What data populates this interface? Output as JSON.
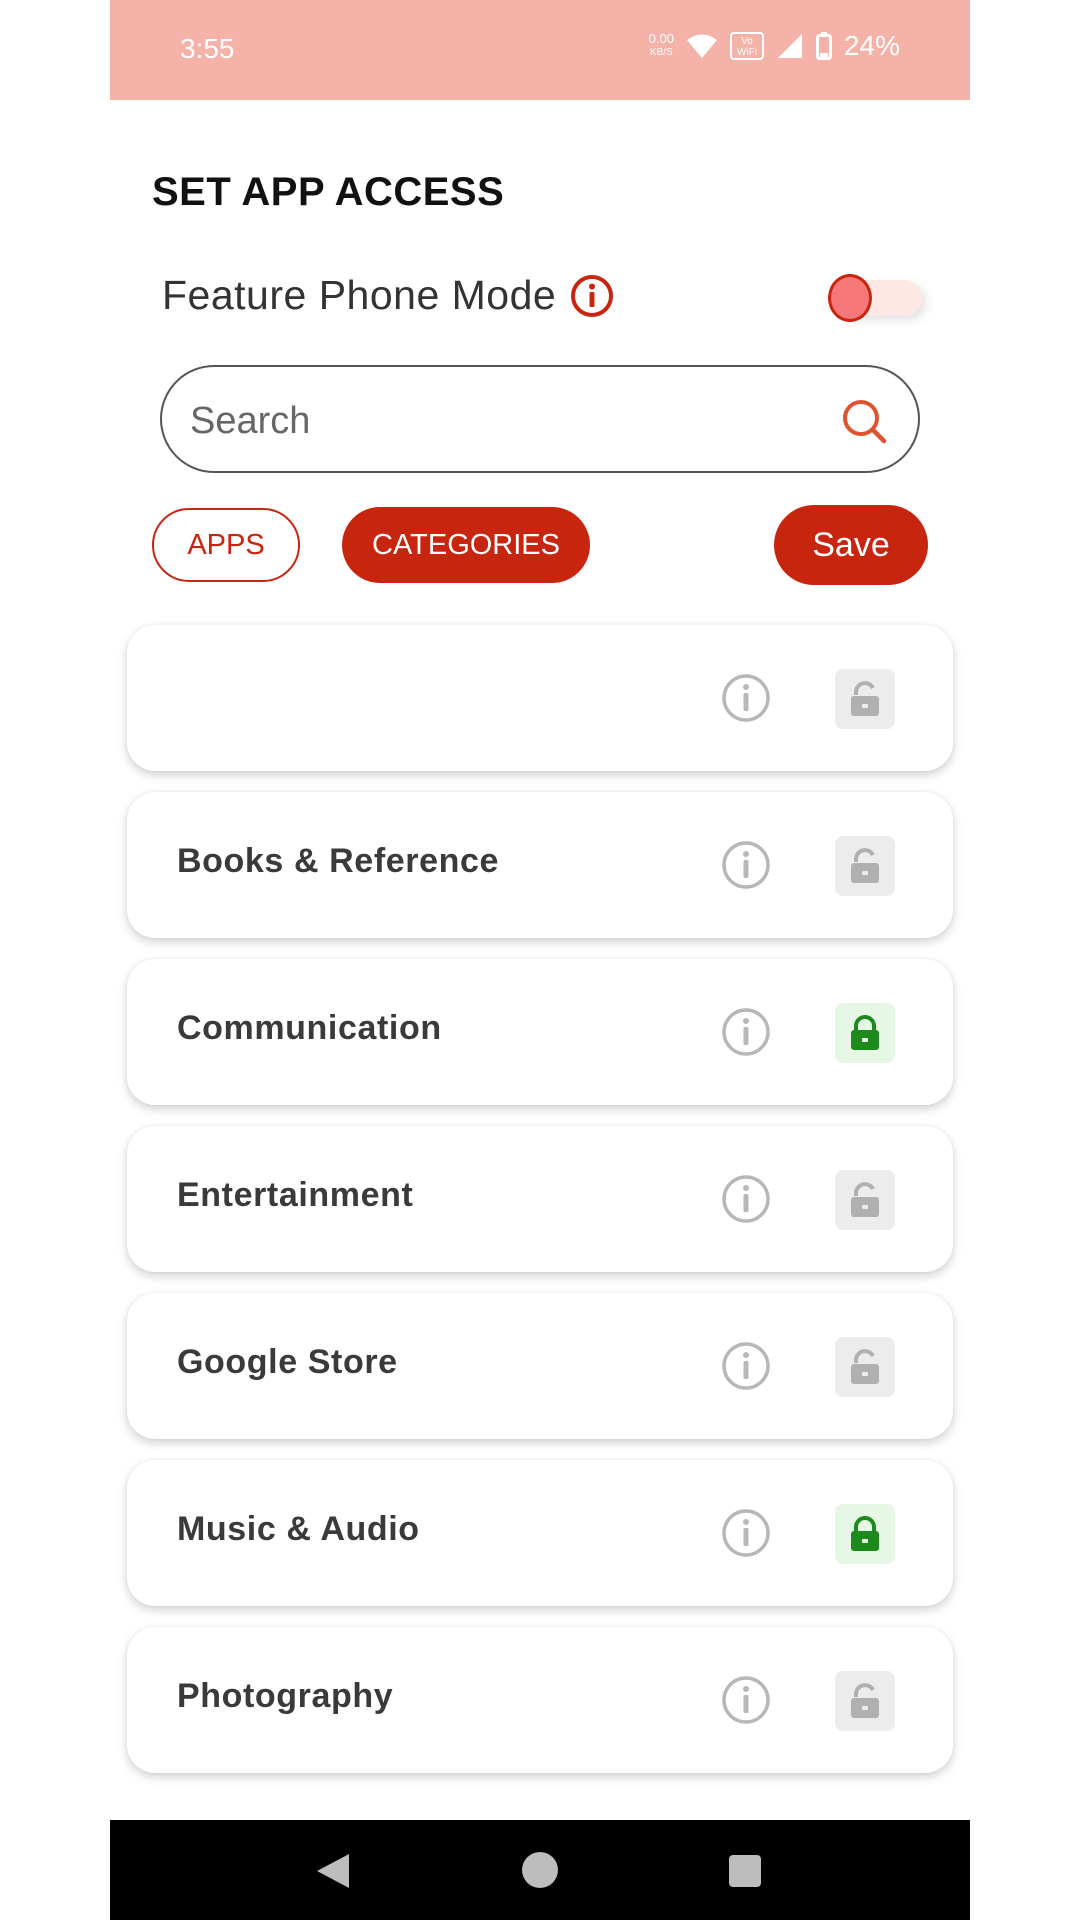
{
  "status_bar": {
    "time": "3:55",
    "net_speed_value": "0.00",
    "net_speed_unit": "KB/S",
    "volte_line1": "Vo",
    "volte_line2": "WiFi",
    "battery": "24%"
  },
  "title": "SET APP ACCESS",
  "feature_phone_mode": {
    "label": "Feature Phone Mode",
    "enabled": false
  },
  "search": {
    "placeholder": "Search",
    "value": ""
  },
  "tabs": {
    "apps_label": "APPS",
    "categories_label": "CATEGORIES",
    "active": "CATEGORIES"
  },
  "save_label": "Save",
  "colors": {
    "accent": "#c8250f",
    "status_bar": "#f5b2a8",
    "locked_green": "#1e8a1e",
    "unlocked_gray": "#b0b0b0"
  },
  "categories": [
    {
      "label": "",
      "locked": false
    },
    {
      "label": "Books & Reference",
      "locked": false
    },
    {
      "label": "Communication",
      "locked": true
    },
    {
      "label": "Entertainment",
      "locked": false
    },
    {
      "label": "Google Store",
      "locked": false
    },
    {
      "label": "Music & Audio",
      "locked": true
    },
    {
      "label": "Photography",
      "locked": false
    }
  ]
}
